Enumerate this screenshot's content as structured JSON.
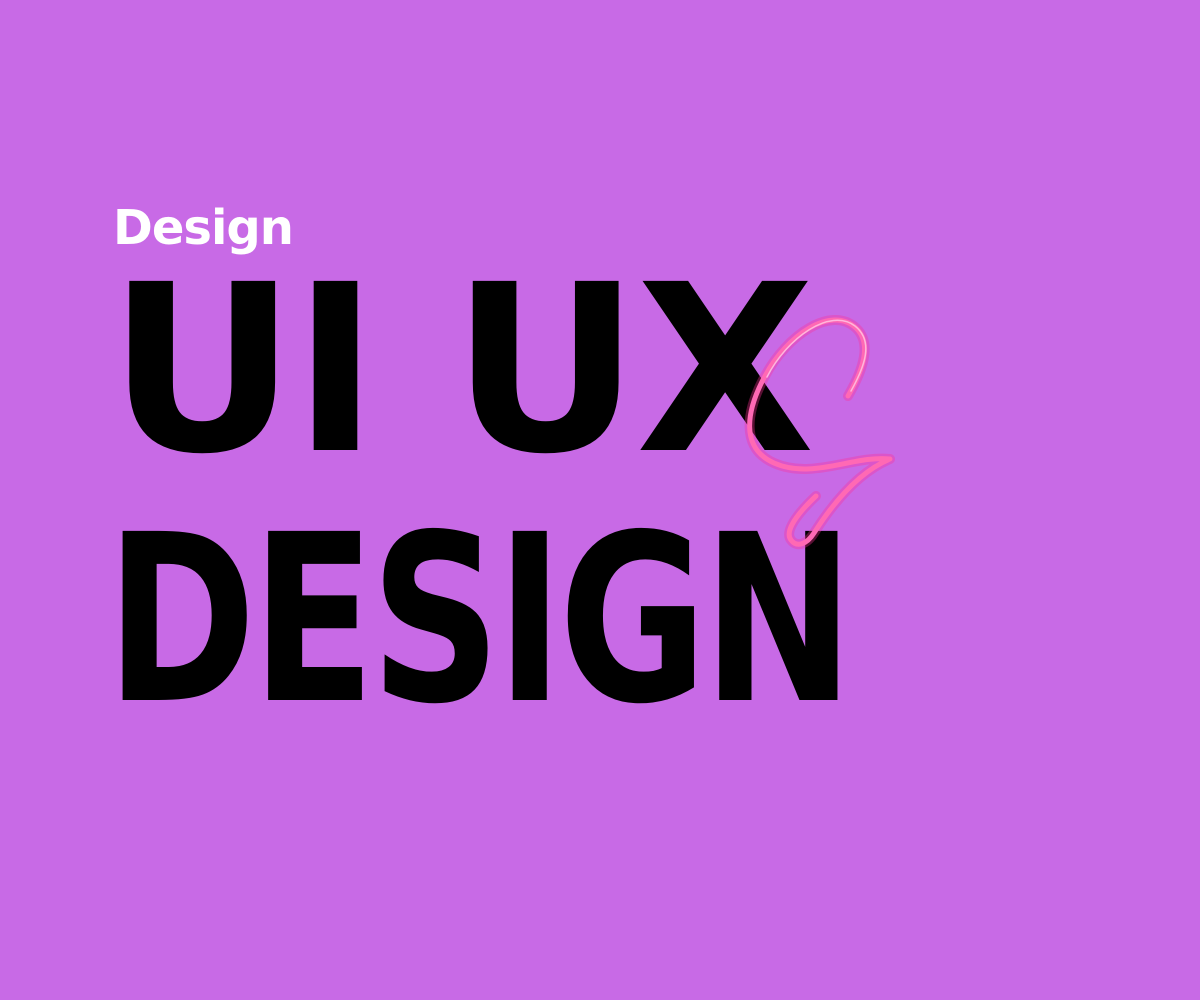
{
  "colors": {
    "background": "#c86ae6",
    "kicker": "#ffffff",
    "headline": "#000000",
    "ampersand": "#ff69b4",
    "ampersand_glow": "#ff2f96"
  },
  "kicker": "Design",
  "headline": {
    "line1": "UI UX",
    "line2": "DESIGN"
  },
  "ampersand_icon": "script-ampersand"
}
